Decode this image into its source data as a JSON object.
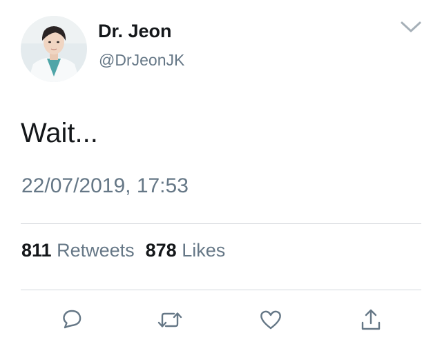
{
  "tweet": {
    "author": {
      "display_name": "Dr. Jeon",
      "handle": "@DrJeonJK",
      "avatar": "profile-photo"
    },
    "text": "Wait...",
    "timestamp": "22/07/2019, 17:53",
    "stats": {
      "retweets_count": "811",
      "retweets_label": "Retweets",
      "likes_count": "878",
      "likes_label": "Likes"
    },
    "actions": [
      {
        "icon": "reply-icon"
      },
      {
        "icon": "retweet-icon"
      },
      {
        "icon": "like-icon"
      },
      {
        "icon": "share-icon"
      }
    ],
    "menu_icon": "chevron-down-icon"
  },
  "colors": {
    "primary_text": "#14171a",
    "secondary_text": "#657786",
    "divider": "#d3d7db",
    "icon": "#657786"
  }
}
